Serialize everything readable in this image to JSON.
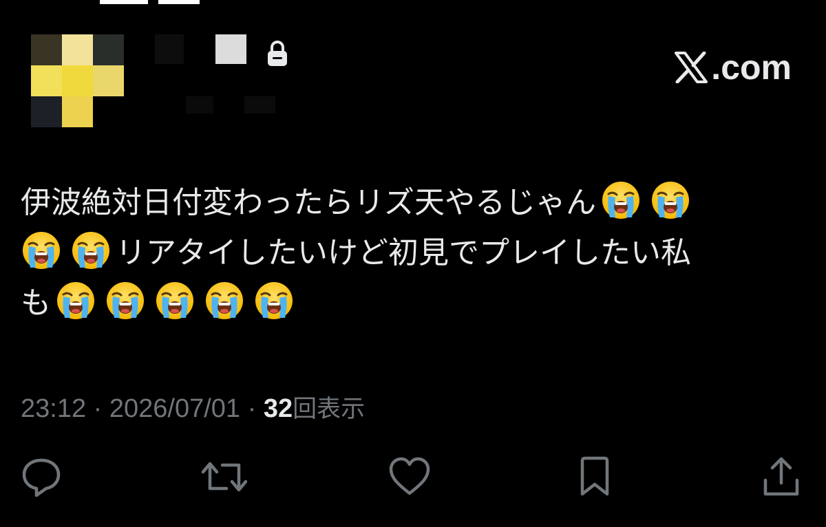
{
  "brand": {
    "site_label": ".com"
  },
  "tweet": {
    "line1": "伊波絶対日付変わったらリズ天やるじゃん",
    "line2": "リアタイしたいけど初見でプレイしたい私",
    "line3": "も",
    "emoji_name": "loudly-crying-face"
  },
  "meta": {
    "time": "23:12",
    "separator": " · ",
    "date": "2026/07/01",
    "views_count": "32",
    "views_label": "回表示"
  },
  "actions": [
    {
      "name": "reply",
      "icon": "speech-bubble-icon"
    },
    {
      "name": "repost",
      "icon": "repost-arrows-icon"
    },
    {
      "name": "like",
      "icon": "heart-icon"
    },
    {
      "name": "bookmark",
      "icon": "bookmark-icon"
    },
    {
      "name": "share",
      "icon": "share-upload-icon"
    }
  ],
  "colors": {
    "background": "#000000",
    "text_primary": "#e7e9ea",
    "text_secondary": "#71767b"
  }
}
